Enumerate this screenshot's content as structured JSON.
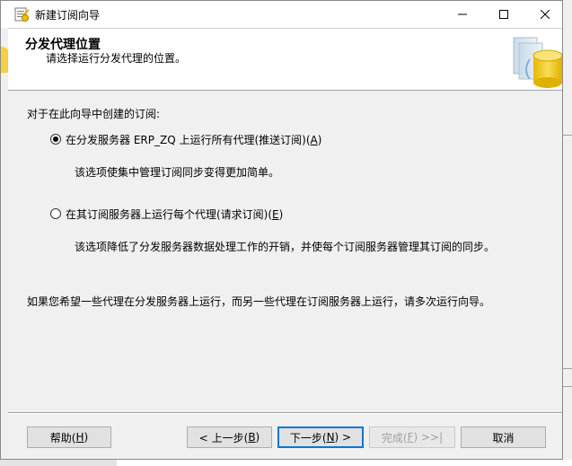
{
  "window": {
    "title": "新建订阅向导"
  },
  "header": {
    "title": "分发代理位置",
    "subtitle": "请选择运行分发代理的位置。"
  },
  "main": {
    "prompt": "对于在此向导中创建的订阅:",
    "options": [
      {
        "label": "在分发服务器 ERP_ZQ 上运行所有代理(推送订阅)(",
        "accel": "A",
        "label_end": ")",
        "checked": true,
        "description": "该选项使集中管理订阅同步变得更加简单。"
      },
      {
        "label": "在其订阅服务器上运行每个代理(请求订阅)(",
        "accel": "E",
        "label_end": ")",
        "checked": false,
        "description": "该选项降低了分发服务器数据处理工作的开销，并使每个订阅服务器管理其订阅的同步。"
      }
    ],
    "note": "如果您希望一些代理在分发服务器上运行，而另一些代理在订阅服务器上运行，请多次运行向导。"
  },
  "footer": {
    "help": {
      "pre": "帮助(",
      "accel": "H",
      "post": ")"
    },
    "back": {
      "pre": "< 上一步(",
      "accel": "B",
      "post": ")"
    },
    "next": {
      "pre": "下一步(",
      "accel": "N",
      "post": ") >"
    },
    "finish": {
      "pre": "完成(",
      "accel": "F",
      "post": ") >>|"
    },
    "cancel": "取消"
  }
}
